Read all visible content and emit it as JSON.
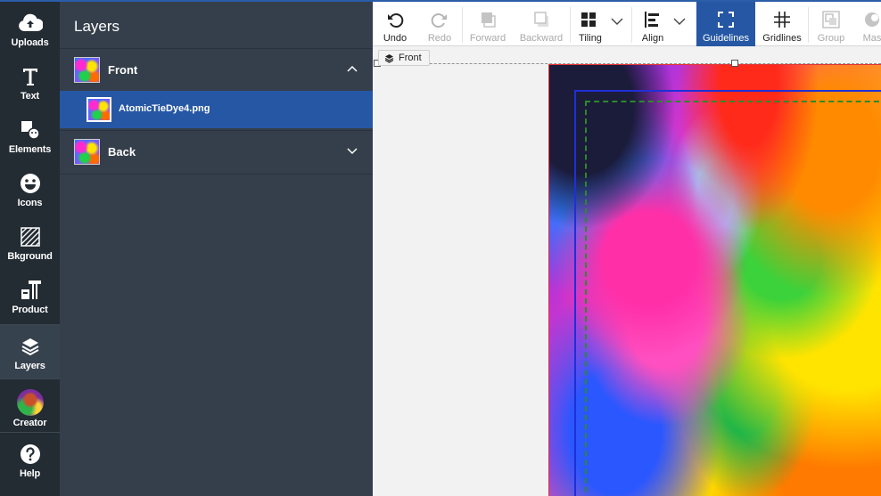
{
  "rail": {
    "items": [
      {
        "label": "Uploads",
        "icon": "cloud-upload-icon"
      },
      {
        "label": "Text",
        "icon": "text-t-icon"
      },
      {
        "label": "Elements",
        "icon": "shapes-icon"
      },
      {
        "label": "Icons",
        "icon": "smiley-icon"
      },
      {
        "label": "Bkground",
        "icon": "hatch-icon"
      },
      {
        "label": "Product",
        "icon": "product-icon"
      },
      {
        "label": "Layers",
        "icon": "layers-icon"
      },
      {
        "label": "Creator",
        "icon": "avatar-icon"
      },
      {
        "label": "Help",
        "icon": "help-icon"
      }
    ],
    "active": "Layers"
  },
  "panel": {
    "title": "Layers",
    "layers": [
      {
        "name": "Front",
        "expanded": true,
        "children": [
          {
            "name": "AtomicTieDye4.png"
          }
        ]
      },
      {
        "name": "Back",
        "expanded": false,
        "children": []
      }
    ]
  },
  "toolbar": {
    "undo": "Undo",
    "redo": "Redo",
    "forward": "Forward",
    "backward": "Backward",
    "tiling": "Tiling",
    "align": "Align",
    "guidelines": "Guidelines",
    "gridlines": "Gridlines",
    "group": "Group",
    "mask": "Mas"
  },
  "canvas": {
    "side_label": "Front"
  },
  "colors": {
    "accent": "#2657a4",
    "rail_bg": "#232b33",
    "panel_bg": "#353f4b"
  }
}
